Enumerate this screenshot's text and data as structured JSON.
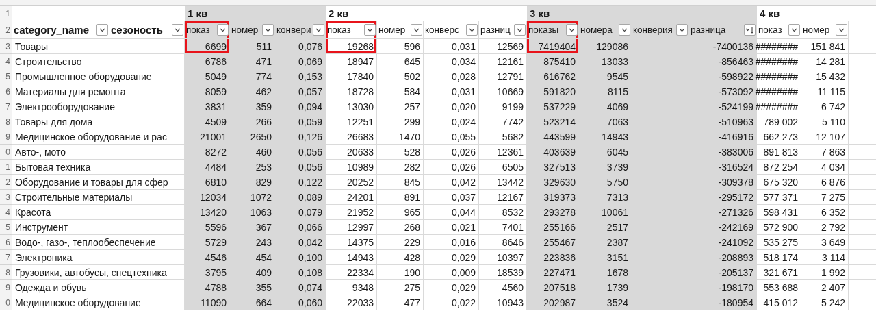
{
  "columns": [
    {
      "header": "category_name",
      "shaded": false,
      "highlighted": false,
      "sorted": false
    },
    {
      "header": "сезоность",
      "shaded": false,
      "highlighted": false,
      "sorted": false
    },
    {
      "group": "1 кв",
      "header": "показ",
      "shaded": true,
      "highlighted": true,
      "sorted": false
    },
    {
      "header": "номер",
      "shaded": true,
      "highlighted": false,
      "sorted": false
    },
    {
      "header": "конвери",
      "shaded": true,
      "highlighted": false,
      "sorted": false
    },
    {
      "group": "2 кв",
      "header": "показ",
      "shaded": false,
      "highlighted": true,
      "sorted": false
    },
    {
      "header": "номер",
      "shaded": false,
      "highlighted": false,
      "sorted": false
    },
    {
      "header": "конверс",
      "shaded": false,
      "highlighted": false,
      "sorted": false
    },
    {
      "header": "разниц",
      "shaded": false,
      "highlighted": false,
      "sorted": false
    },
    {
      "group": "3 кв",
      "header": "показы",
      "shaded": true,
      "highlighted": true,
      "sorted": false
    },
    {
      "header": "номера",
      "shaded": true,
      "highlighted": false,
      "sorted": false
    },
    {
      "header": "конверия",
      "shaded": true,
      "highlighted": false,
      "sorted": false
    },
    {
      "header": "разница",
      "shaded": true,
      "highlighted": false,
      "sorted": true
    },
    {
      "group": "4 кв",
      "header": "показ",
      "shaded": false,
      "highlighted": false,
      "sorted": false
    },
    {
      "header": "номер",
      "shaded": false,
      "highlighted": false,
      "sorted": false
    }
  ],
  "header_rows": [
    {
      "num": "1"
    },
    {
      "num": "2"
    }
  ],
  "rows": [
    {
      "num": "3",
      "cells": [
        "Товары",
        null,
        "6699",
        "511",
        "0,076",
        "19268",
        "596",
        "0,031",
        "12569",
        "7419404",
        "129086",
        null,
        "-7400136",
        "########",
        "151 841"
      ]
    },
    {
      "num": "4",
      "cells": [
        "Строительство",
        null,
        "6786",
        "471",
        "0,069",
        "18947",
        "645",
        "0,034",
        "12161",
        "875410",
        "13033",
        null,
        "-856463",
        "########",
        "14 281"
      ]
    },
    {
      "num": "5",
      "cells": [
        "Промышленное оборудование",
        null,
        "5049",
        "774",
        "0,153",
        "17840",
        "502",
        "0,028",
        "12791",
        "616762",
        "9545",
        null,
        "-598922",
        "########",
        "15 432"
      ]
    },
    {
      "num": "6",
      "cells": [
        "Материалы для ремонта",
        null,
        "8059",
        "462",
        "0,057",
        "18728",
        "584",
        "0,031",
        "10669",
        "591820",
        "8115",
        null,
        "-573092",
        "########",
        "11 115"
      ]
    },
    {
      "num": "7",
      "cells": [
        "Электрооборудование",
        null,
        "3831",
        "359",
        "0,094",
        "13030",
        "257",
        "0,020",
        "9199",
        "537229",
        "4069",
        null,
        "-524199",
        "########",
        "6 742"
      ]
    },
    {
      "num": "8",
      "cells": [
        "Товары для дома",
        null,
        "4509",
        "266",
        "0,059",
        "12251",
        "299",
        "0,024",
        "7742",
        "523214",
        "7063",
        null,
        "-510963",
        "789 002",
        "5 110"
      ]
    },
    {
      "num": "9",
      "cells": [
        "Медицинское оборудование и рас",
        null,
        "21001",
        "2650",
        "0,126",
        "26683",
        "1470",
        "0,055",
        "5682",
        "443599",
        "14943",
        null,
        "-416916",
        "662 273",
        "12 107"
      ]
    },
    {
      "num": "0",
      "cells": [
        "Авто-, мото",
        null,
        "8272",
        "460",
        "0,056",
        "20633",
        "528",
        "0,026",
        "12361",
        "403639",
        "6045",
        null,
        "-383006",
        "891 813",
        "7 863"
      ]
    },
    {
      "num": "1",
      "cells": [
        "Бытовая техника",
        null,
        "4484",
        "253",
        "0,056",
        "10989",
        "282",
        "0,026",
        "6505",
        "327513",
        "3739",
        null,
        "-316524",
        "872 254",
        "4 034"
      ]
    },
    {
      "num": "2",
      "cells": [
        "Оборудование и товары для сфер",
        null,
        "6810",
        "829",
        "0,122",
        "20252",
        "845",
        "0,042",
        "13442",
        "329630",
        "5750",
        null,
        "-309378",
        "675 320",
        "6 876"
      ]
    },
    {
      "num": "3",
      "cells": [
        "Строительные материалы",
        null,
        "12034",
        "1072",
        "0,089",
        "24201",
        "891",
        "0,037",
        "12167",
        "319373",
        "7313",
        null,
        "-295172",
        "577 371",
        "7 275"
      ]
    },
    {
      "num": "4",
      "cells": [
        "Красота",
        null,
        "13420",
        "1063",
        "0,079",
        "21952",
        "965",
        "0,044",
        "8532",
        "293278",
        "10061",
        null,
        "-271326",
        "598 431",
        "6 352"
      ]
    },
    {
      "num": "5",
      "cells": [
        "Инструмент",
        null,
        "5596",
        "367",
        "0,066",
        "12997",
        "268",
        "0,021",
        "7401",
        "255166",
        "2517",
        null,
        "-242169",
        "572 900",
        "2 792"
      ]
    },
    {
      "num": "6",
      "cells": [
        "Водо-, газо-, теплообеспечение",
        null,
        "5729",
        "243",
        "0,042",
        "14375",
        "229",
        "0,016",
        "8646",
        "255467",
        "2387",
        null,
        "-241092",
        "535 275",
        "3 649"
      ]
    },
    {
      "num": "7",
      "cells": [
        "Электроника",
        null,
        "4546",
        "454",
        "0,100",
        "14943",
        "428",
        "0,029",
        "10397",
        "223836",
        "3151",
        null,
        "-208893",
        "518 174",
        "3 114"
      ]
    },
    {
      "num": "8",
      "cells": [
        "Грузовики, автобусы, спецтехника",
        null,
        "3795",
        "409",
        "0,108",
        "22334",
        "190",
        "0,009",
        "18539",
        "227471",
        "1678",
        null,
        "-205137",
        "321 671",
        "1 992"
      ]
    },
    {
      "num": "9",
      "cells": [
        "Одежда и обувь",
        null,
        "4788",
        "355",
        "0,074",
        "9348",
        "275",
        "0,029",
        "4560",
        "207518",
        "1739",
        null,
        "-198170",
        "553 688",
        "2 407"
      ]
    },
    {
      "num": "0",
      "cells": [
        "Медицинское оборудование",
        null,
        "11090",
        "664",
        "0,060",
        "22033",
        "477",
        "0,022",
        "10943",
        "202987",
        "3524",
        null,
        "-180954",
        "415 012",
        "5 242"
      ]
    }
  ]
}
